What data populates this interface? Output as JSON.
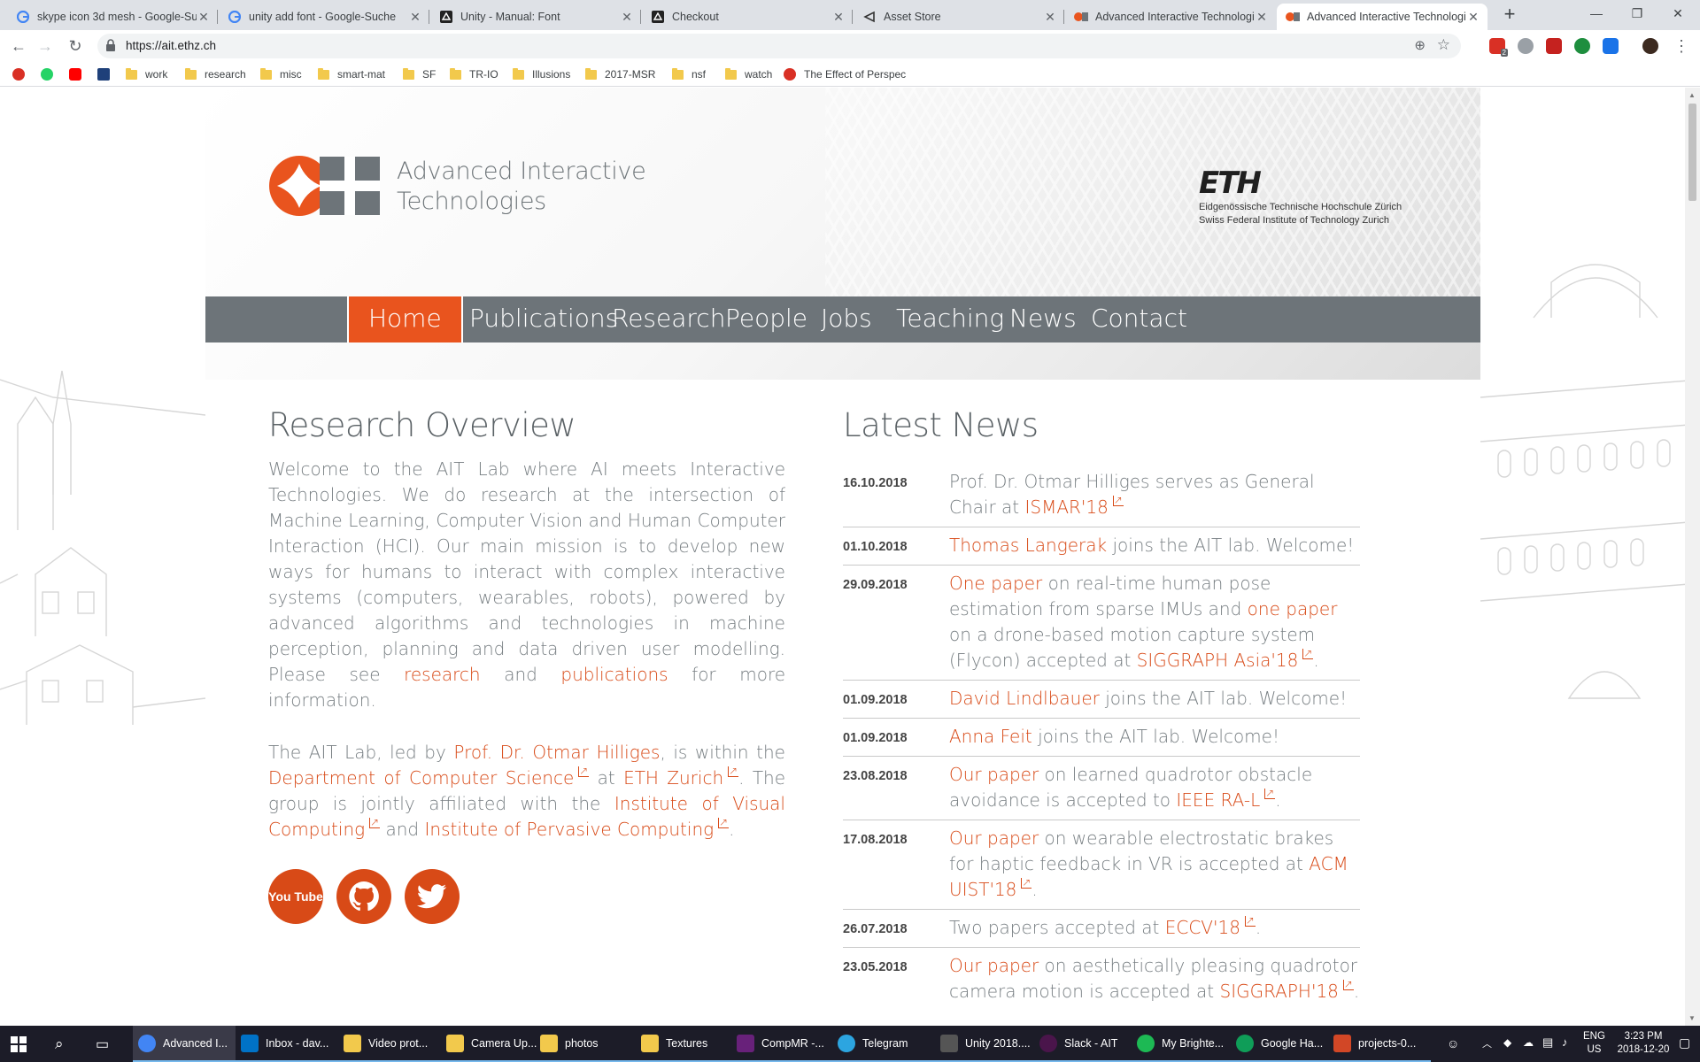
{
  "browser": {
    "tabs": [
      {
        "title": "skype icon 3d mesh - Google-Su",
        "favicon": "google-icon",
        "active": false
      },
      {
        "title": "unity add font - Google-Suche",
        "favicon": "google-icon",
        "active": false
      },
      {
        "title": "Unity - Manual: Font",
        "favicon": "unity-icon",
        "active": false
      },
      {
        "title": "Checkout",
        "favicon": "unity-icon",
        "active": false
      },
      {
        "title": "Asset Store",
        "favicon": "unity-asset-store-icon",
        "active": false
      },
      {
        "title": "Advanced Interactive Technologie",
        "favicon": "ait-icon",
        "active": false
      },
      {
        "title": "Advanced Interactive Technologie",
        "favicon": "ait-icon",
        "active": true
      }
    ],
    "url": "https://ait.ethz.ch",
    "bookmarks": [
      {
        "label": "",
        "icon": "target-icon"
      },
      {
        "label": "",
        "icon": "whatsapp-icon"
      },
      {
        "label": "",
        "icon": "youtube-icon"
      },
      {
        "label": "",
        "icon": "eth-icon"
      },
      {
        "label": "work",
        "icon": "folder-icon"
      },
      {
        "label": "research",
        "icon": "folder-icon"
      },
      {
        "label": "misc",
        "icon": "folder-icon"
      },
      {
        "label": "smart-mat",
        "icon": "folder-icon"
      },
      {
        "label": "SF",
        "icon": "folder-icon"
      },
      {
        "label": "TR-IO",
        "icon": "folder-icon"
      },
      {
        "label": "Illusions",
        "icon": "folder-icon"
      },
      {
        "label": "2017-MSR",
        "icon": "folder-icon"
      },
      {
        "label": "nsf",
        "icon": "folder-icon"
      },
      {
        "label": "watch",
        "icon": "folder-icon"
      },
      {
        "label": "The Effect of Perspec",
        "icon": "bookmark-page-icon"
      }
    ],
    "extension_badge": "2"
  },
  "site": {
    "logo_line1": "Advanced Interactive",
    "logo_line2": "Technologies",
    "eth_wordmark": "ETH",
    "eth_line1": "Eidgenössische Technische Hochschule Zürich",
    "eth_line2": "Swiss Federal Institute of Technology Zurich",
    "nav": [
      "Home",
      "Publications",
      "Research",
      "People",
      "Jobs",
      "Teaching",
      "News",
      "Contact"
    ],
    "nav_active": "Home"
  },
  "overview": {
    "title": "Research Overview",
    "p1_text": "Welcome to the AIT Lab where AI meets Interactive Technologies. We do research at the intersection of Machine Learning, Computer Vision and Human Computer Interaction (HCI). Our main mission is to develop new ways for humans to interact with complex interactive systems (computers, wearables, robots), powered by advanced algorithms and technologies in machine perception, planning and data driven user modelling. Please see",
    "p1_link1": "research",
    "p1_and": "and",
    "p1_link2": "publications",
    "p1_end": "for more information.",
    "p2_a": "The AIT Lab, led by",
    "p2_link_prof": "Prof. Dr. Otmar Hilliges",
    "p2_b": ", is within the",
    "p2_link_dept": "Department of Computer Science",
    "p2_at": "at",
    "p2_link_eth": "ETH Zurich",
    "p2_c": ". The group is jointly affiliated with the",
    "p2_link_ivc": "Institute of Visual Computing",
    "p2_and": "and",
    "p2_link_ipc": "Institute of Pervasive Computing",
    "p2_end": ".",
    "social": [
      {
        "name": "youtube-icon",
        "label": "You Tube"
      },
      {
        "name": "github-icon",
        "label": ""
      },
      {
        "name": "twitter-icon",
        "label": ""
      }
    ]
  },
  "news": {
    "title": "Latest News",
    "items": [
      {
        "date": "16.10.2018",
        "text": "Prof. Dr. Otmar Hilliges serves as General Chair at ",
        "link": "ISMAR'18",
        "after": ""
      },
      {
        "date": "01.10.2018",
        "link_first": "Thomas Langerak",
        "text": " joins the AIT lab. Welcome!"
      },
      {
        "date": "29.09.2018",
        "link_first": "One paper",
        "text": " on real-time human pose estimation from sparse IMUs and ",
        "link_mid": "one paper",
        "text2": " on a drone-based motion capture system (Flycon) accepted at ",
        "link": "SIGGRAPH Asia'18",
        "after": "."
      },
      {
        "date": "01.09.2018",
        "link_first": "David Lindlbauer",
        "text": " joins the AIT lab. Welcome!"
      },
      {
        "date": "01.09.2018",
        "link_first": "Anna Feit",
        "text": " joins the AIT lab. Welcome!"
      },
      {
        "date": "23.08.2018",
        "link_first": "Our paper",
        "text": " on learned quadrotor obstacle avoidance is accepted to ",
        "link": "IEEE RA-L",
        "after": "."
      },
      {
        "date": "17.08.2018",
        "link_first": "Our paper",
        "text": " on wearable electrostatic brakes for haptic feedback in VR is accepted at ",
        "link": "ACM UIST'18",
        "after": "."
      },
      {
        "date": "26.07.2018",
        "text": "Two papers accepted at ",
        "link": "ECCV'18",
        "after": "."
      },
      {
        "date": "23.05.2018",
        "link_first": "Our paper",
        "text": " on aesthetically pleasing quadrotor camera motion is accepted at ",
        "link": "SIGGRAPH'18",
        "after": "."
      }
    ]
  },
  "taskbar": {
    "apps": [
      {
        "label": "Advanced I...",
        "icon": "chrome-icon",
        "active": true
      },
      {
        "label": "Inbox - dav...",
        "icon": "outlook-icon"
      },
      {
        "label": "Video prot...",
        "icon": "folder-icon"
      },
      {
        "label": "Camera Up...",
        "icon": "folder-icon"
      },
      {
        "label": "photos",
        "icon": "folder-icon"
      },
      {
        "label": "Textures",
        "icon": "folder-icon"
      },
      {
        "label": "CompMR -...",
        "icon": "visual-studio-icon"
      },
      {
        "label": "Telegram",
        "icon": "telegram-icon"
      },
      {
        "label": "Unity 2018....",
        "icon": "unity-icon"
      },
      {
        "label": "Slack - AIT",
        "icon": "slack-icon"
      },
      {
        "label": "My Brighte...",
        "icon": "spotify-icon"
      },
      {
        "label": "Google Ha...",
        "icon": "hangouts-icon"
      },
      {
        "label": "projects-0...",
        "icon": "powerpoint-icon"
      }
    ],
    "lang_line1": "ENG",
    "lang_line2": "US",
    "time": "3:23 PM",
    "date": "2018-12-20"
  },
  "colors": {
    "accent": "#d84a17",
    "nav_bg": "#6d7479",
    "nav_active": "#e9541e",
    "text": "#777e82"
  }
}
